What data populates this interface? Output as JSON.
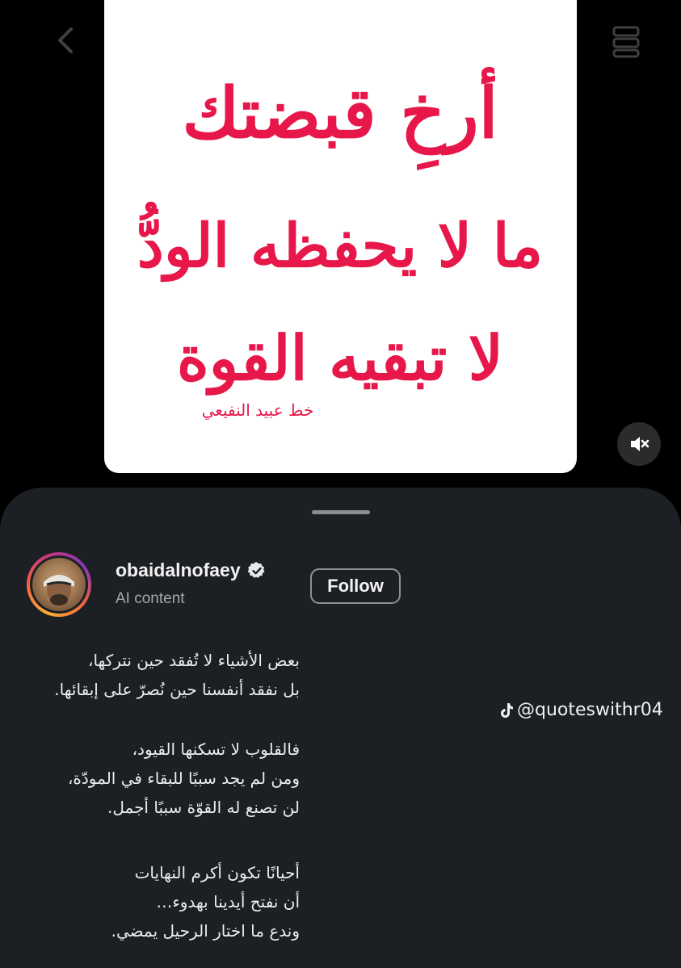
{
  "post": {
    "image_text_lines": [
      "أرخِ قبضتك",
      "ما لا يحفظه الودُّ",
      "لا تبقيه القوة"
    ],
    "image_signature": "خط عبيد النفيعي",
    "calligraphy_color": "#e8174a"
  },
  "profile": {
    "username": "obaidalnofaey",
    "verified": true,
    "subtitle": "AI content",
    "follow_label": "Follow"
  },
  "caption": {
    "paragraphs": [
      [
        "بعض الأشياء لا تُفقد حين نتركها،",
        "بل نفقد أنفسنا حين نُصرّ على إبقائها."
      ],
      [
        "فالقلوب لا تسكنها القيود،",
        "ومن لم يجد سببًا للبقاء في المودّة،",
        "لن تصنع له القوّة سببًا أجمل."
      ],
      [
        "أحيانًا تكون أكرم النهايات",
        "أن نفتح أيدينا بهدوء…",
        "وندع ما اختار الرحيل يمضي."
      ]
    ]
  },
  "watermark": {
    "handle": "@quoteswithr04",
    "icon": "tiktok-icon"
  },
  "icons": {
    "mute": "speaker-muted-icon",
    "back": "back-arrow-icon",
    "top_right": "layers-icon"
  }
}
